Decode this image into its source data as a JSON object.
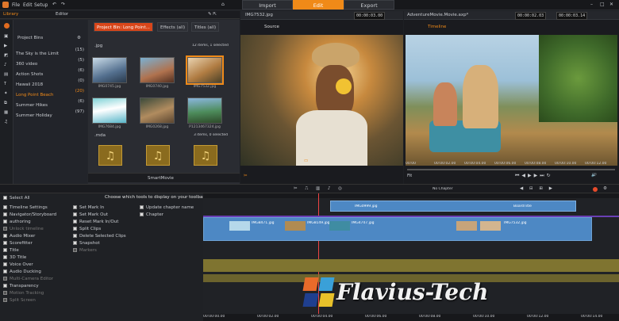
{
  "menu": {
    "file": "File",
    "edit": "Edit",
    "setup": "Setup"
  },
  "modes": {
    "import": "Import",
    "edit": "Edit",
    "export": "Export"
  },
  "library": {
    "tab_library": "Library",
    "tab_editor": "Editor",
    "bins_title": "Project Bins",
    "bins": [
      {
        "name": "The Sky is the Limit",
        "count": "(15)"
      },
      {
        "name": "360 video",
        "count": "(5)"
      },
      {
        "name": "Action Shots",
        "count": "(6)"
      },
      {
        "name": "Hawaii 2018",
        "count": "(0)"
      },
      {
        "name": "Long Point Beach",
        "count": "(20)"
      },
      {
        "name": "Summer Hikes",
        "count": "(6)"
      },
      {
        "name": "Summer Holiday",
        "count": "(97)"
      }
    ],
    "panel_tabs": [
      "Project Bin: Long Point...",
      "Effects (all)",
      "Titles (all)"
    ],
    "group_jpg": ".jpg",
    "group_jpg_info": "12 items, 1 selected",
    "thumbs": [
      {
        "label": "IMG0745.jpg"
      },
      {
        "label": "IMG0740.jpg"
      },
      {
        "label": "IMG7532.jpg"
      },
      {
        "label": "IMG7684.jpg"
      },
      {
        "label": "IMG0268.jpg"
      },
      {
        "label": "P1213467324.jpg"
      }
    ],
    "group_mda": ".mda",
    "group_mda_info": "3 items, 0 selected",
    "smartmovie": "SmartMovie"
  },
  "source": {
    "file": "IMG7532.jpg",
    "timecode": "00:00:03.00",
    "label": "Source"
  },
  "target": {
    "file": "AdventureMovie.Movie.axp*",
    "timecode": "00:00:02.03",
    "timecode2": "00:00:03.14",
    "label": "Timeline",
    "scale": [
      "00:00",
      "00:00:02.00",
      "00:00:04.00",
      "00:00:06.00",
      "00:00:08.00",
      "00:00:10.00",
      "00:00:12.00",
      "00:00:14"
    ],
    "fit": "Fit"
  },
  "toolbar_options": {
    "title": "Choose which tools to display on your toolbar",
    "select_all": "Select All",
    "col1": [
      "Timeline Settings",
      "Navigator/Storyboard",
      "authoring",
      "Unlock timeline",
      "Audio Mixer",
      "Scorefitter",
      "Title",
      "3D Title",
      "Voice Over",
      "Audio Ducking",
      "Multi-Camera Editor",
      "Transparency",
      "Motion Tracking",
      "Split Screen"
    ],
    "col2": [
      "Set Mark In",
      "Set Mark Out",
      "Reset Mark In/Out",
      "Split Clips",
      "Delete Selected Clips",
      "Snapshot",
      "Markers"
    ],
    "col3": [
      "Update chapter name",
      "Chapter"
    ]
  },
  "timeline": {
    "clips_top": [
      "IMG0999.jpg",
      "BoardTitle"
    ],
    "clips_main": [
      "IMG8149.jpg",
      "IMG8471.jpg",
      "IMG4747.jpg",
      "IMG7532.jpg"
    ],
    "ruler": [
      "00:00:00.00",
      "00:00:02.00",
      "00:00:04.00",
      "00:00:06.00",
      "00:00:08.00",
      "00:00:10.00",
      "00:00:12.00",
      "00:00:14.00"
    ],
    "no_chapter": "No Chapter"
  },
  "watermark": "Flavius-Tech"
}
